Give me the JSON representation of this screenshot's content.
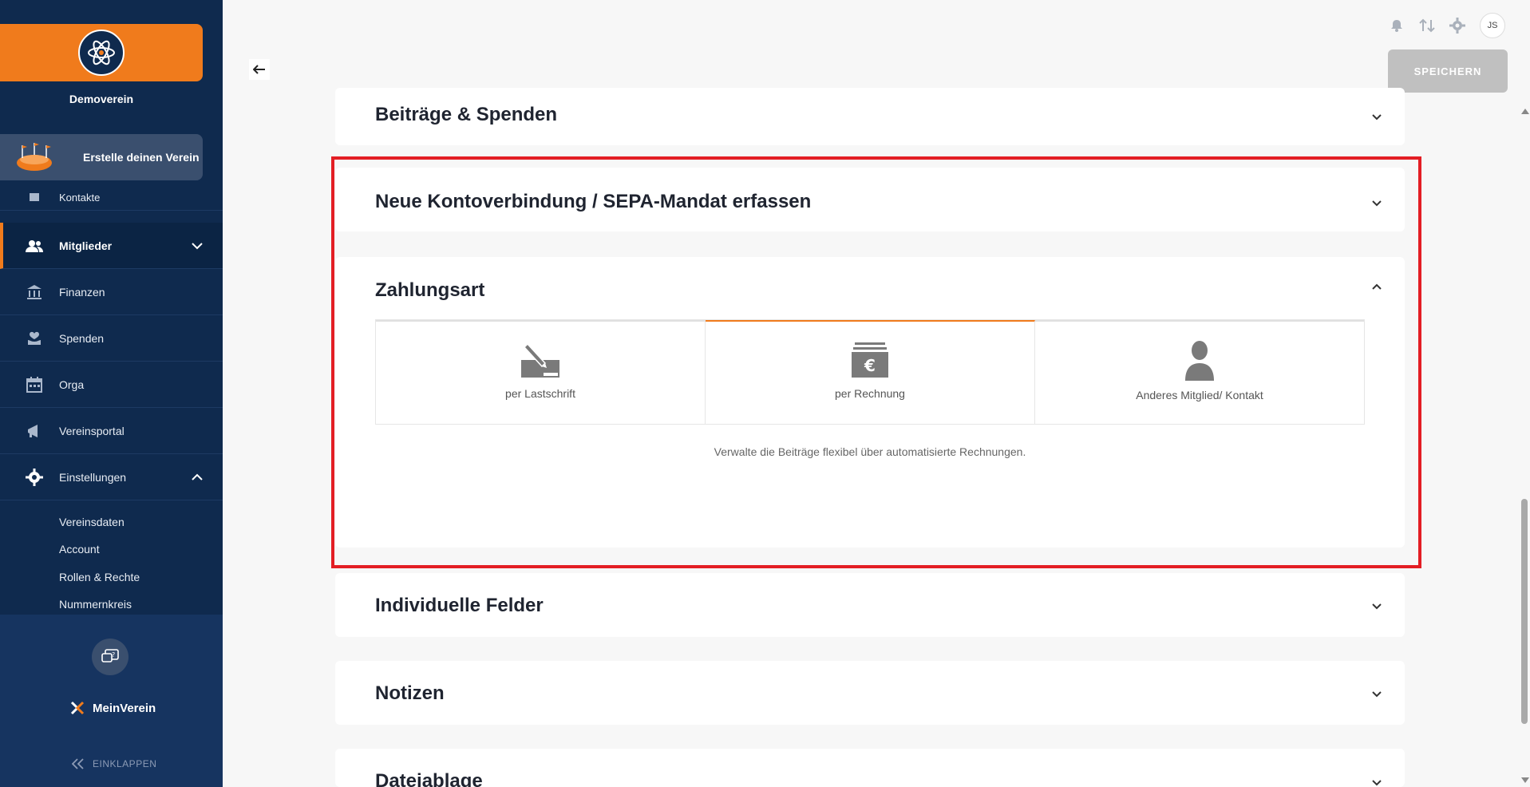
{
  "sidebar": {
    "club_name": "Demoverein",
    "promo_label": "Erstelle deinen Verein",
    "nav": [
      {
        "label": "Kontakte",
        "icon": "contacts-icon"
      },
      {
        "label": "Mitglieder",
        "icon": "members-icon"
      },
      {
        "label": "Finanzen",
        "icon": "bank-icon"
      },
      {
        "label": "Spenden",
        "icon": "donation-icon"
      },
      {
        "label": "Orga",
        "icon": "calendar-icon"
      },
      {
        "label": "Vereinsportal",
        "icon": "megaphone-icon"
      },
      {
        "label": "Einstellungen",
        "icon": "gear-icon"
      }
    ],
    "settings_sub": [
      "Vereinsdaten",
      "Account",
      "Rollen & Rechte",
      "Nummernkreis"
    ],
    "brand": "MeinVerein",
    "collapse_label": "EINKLAPPEN"
  },
  "topbar": {
    "avatar_initials": "JS",
    "save_label": "SPEICHERN"
  },
  "sections": {
    "beitraege": "Beiträge & Spenden",
    "konto": "Neue Kontoverbindung / SEPA-Mandat erfassen",
    "zahlungsart": "Zahlungsart",
    "individuelle": "Individuelle Felder",
    "notizen": "Notizen",
    "dateiablage": "Dateiablage"
  },
  "payment": {
    "options": [
      {
        "label": "per Lastschrift",
        "icon": "direct-debit-icon",
        "selected": false
      },
      {
        "label": "per Rechnung",
        "icon": "invoice-euro-icon",
        "selected": true
      },
      {
        "label": "Anderes Mitglied/ Kontakt",
        "icon": "person-icon",
        "selected": false
      }
    ],
    "description": "Verwalte die Beiträge flexibel über automatisierte Rechnungen."
  },
  "colors": {
    "accent": "#f07b1c",
    "sidebar": "#0f2a4e",
    "highlight": "#e31e24"
  }
}
